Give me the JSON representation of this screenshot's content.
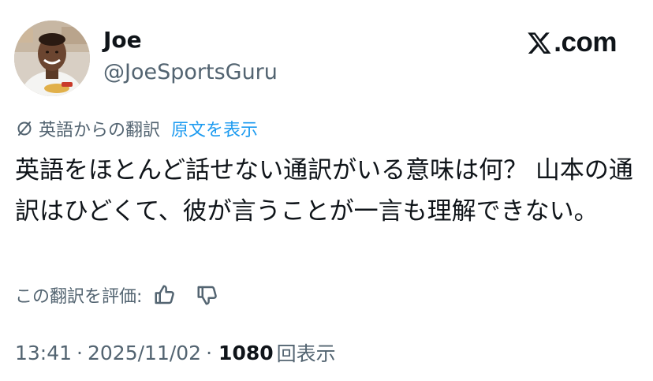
{
  "author": {
    "display_name": "Joe",
    "handle": "@JoeSportsGuru"
  },
  "brand": {
    "label": ".com",
    "icon": "x-logo-icon"
  },
  "translation": {
    "icon": "translate-icon",
    "label": "英語からの翻訳",
    "show_original": "原文を表示"
  },
  "tweet": {
    "text": "英語をほとんど話せない通訳がいる意味は何？ 山本の通訳はひどくて、彼が言うことが一言も理解できない。"
  },
  "rating": {
    "label": "この翻訳を評価:",
    "up_icon": "thumbs-up-icon",
    "down_icon": "thumbs-down-icon"
  },
  "meta": {
    "time": "13:41",
    "separator": "·",
    "date": "2025/11/02",
    "views_count": "1080",
    "views_label": "回表示"
  }
}
